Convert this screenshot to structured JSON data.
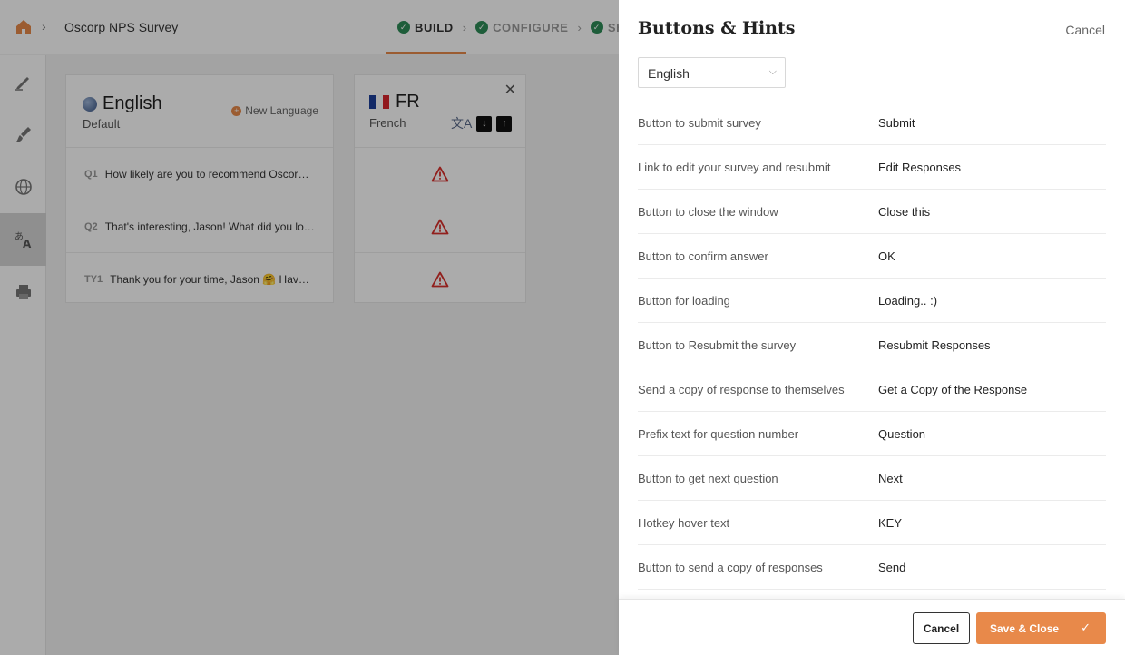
{
  "topbar": {
    "survey_name": "Oscorp NPS Survey",
    "steps": [
      {
        "label": "BUILD",
        "active": true
      },
      {
        "label": "CONFIGURE",
        "active": false
      },
      {
        "label": "SHA",
        "active": false
      }
    ]
  },
  "sidenav": {
    "items": [
      {
        "icon": "pencil-icon"
      },
      {
        "icon": "brush-icon"
      },
      {
        "icon": "globe-icon"
      },
      {
        "icon": "translate-icon",
        "active": true
      },
      {
        "icon": "printer-icon"
      }
    ]
  },
  "languages": {
    "default": {
      "title": "English",
      "subtitle": "Default",
      "new_language": "New Language",
      "questions": [
        {
          "num": "Q1",
          "text": "How likely are you to recommend Oscorp to …"
        },
        {
          "num": "Q2",
          "text": "That's interesting, Jason! What did you love …"
        },
        {
          "num": "TY1",
          "text": "Thank you for your time, Jason 🤗 Have a …"
        }
      ]
    },
    "secondary": {
      "code": "FR",
      "name": "French",
      "flag_colors": [
        "#1d3f9a",
        "#ffffff",
        "#d8262e"
      ],
      "status_icon": "warning-icon"
    }
  },
  "drawer": {
    "title": "Buttons & Hints",
    "cancel_top": "Cancel",
    "language_select": "English",
    "rows": [
      {
        "label": "Button to submit survey",
        "value": "Submit"
      },
      {
        "label": "Link to edit your survey and resubmit",
        "value": "Edit Responses"
      },
      {
        "label": "Button to close the window",
        "value": "Close this"
      },
      {
        "label": "Button to confirm answer",
        "value": "OK"
      },
      {
        "label": "Button for loading",
        "value": "Loading.. :)"
      },
      {
        "label": "Button to Resubmit the survey",
        "value": "Resubmit Responses"
      },
      {
        "label": "Send a copy of response to themselves",
        "value": "Get a Copy of the Response"
      },
      {
        "label": "Prefix text for question number",
        "value": "Question"
      },
      {
        "label": "Button to get next question",
        "value": "Next"
      },
      {
        "label": "Hotkey hover text",
        "value": "KEY"
      },
      {
        "label": "Button to send a copy of responses",
        "value": "Send"
      }
    ],
    "footer": {
      "cancel": "Cancel",
      "save": "Save & Close"
    }
  },
  "colors": {
    "accent": "#e8894a",
    "success": "#2e8b57",
    "warning": "#d9302c"
  }
}
